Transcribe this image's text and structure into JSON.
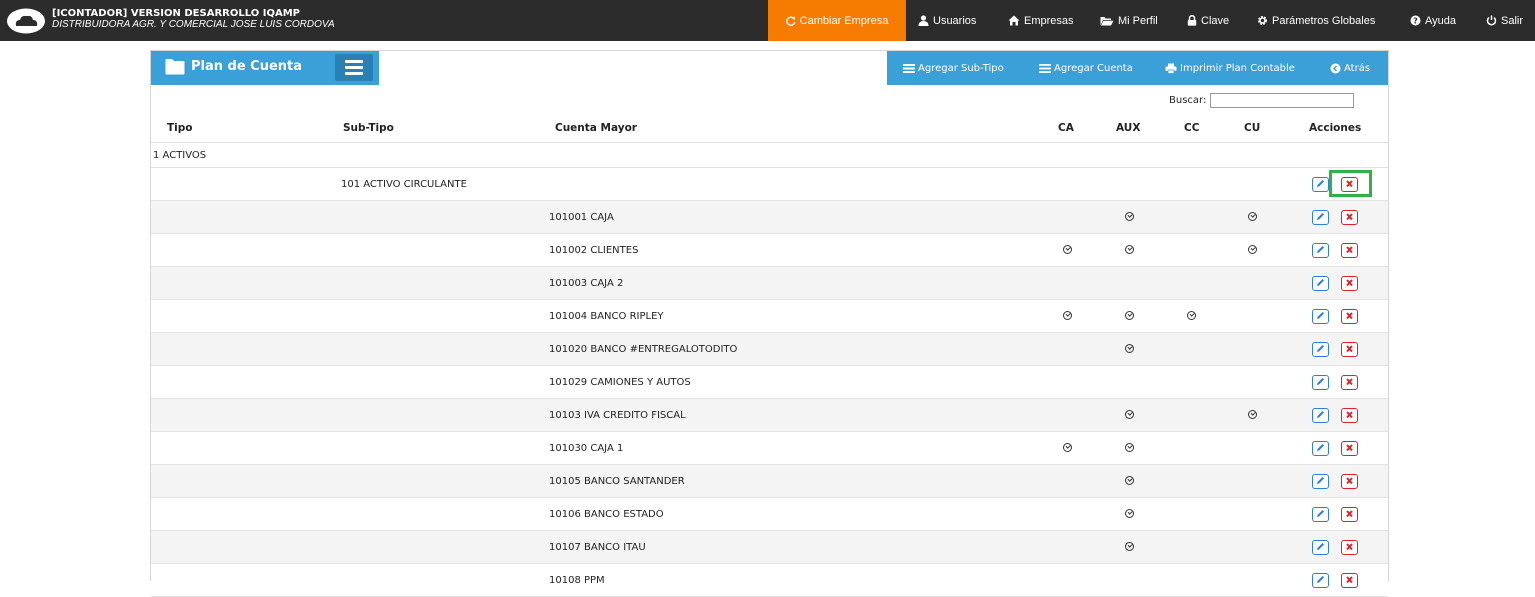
{
  "header": {
    "title": "[ICONTADOR] VERSION DESARROLLO IQAMP",
    "subtitle": "DISTRIBUIDORA AGR. Y COMERCIAL JOSE LUIS CORDOVA",
    "nav": [
      {
        "label": "Cambiar Empresa",
        "icon": "refresh-icon"
      },
      {
        "label": "Usuarios",
        "icon": "user-icon"
      },
      {
        "label": "Empresas",
        "icon": "home-icon"
      },
      {
        "label": "Mi Perfil",
        "icon": "folder-open-icon"
      },
      {
        "label": "Clave",
        "icon": "lock-icon"
      },
      {
        "label": "Parámetros Globales",
        "icon": "gear-icon"
      },
      {
        "label": "Ayuda",
        "icon": "help-icon"
      },
      {
        "label": "Salir",
        "icon": "power-icon"
      }
    ],
    "colors": {
      "bar": "#2c2c2c",
      "active": "#f57c00"
    }
  },
  "panel": {
    "title": "Plan de Cuenta",
    "actions": [
      {
        "label": "Agregar Sub-Tipo",
        "icon": "stack-icon"
      },
      {
        "label": "Agregar Cuenta",
        "icon": "list-icon"
      },
      {
        "label": "Imprimir Plan Contable",
        "icon": "print-icon"
      },
      {
        "label": "Atrás",
        "icon": "back-icon"
      }
    ],
    "search_label": "Buscar:",
    "search_value": "",
    "accent": "#3b9fd8"
  },
  "table": {
    "columns": [
      "Tipo",
      "Sub-Tipo",
      "Cuenta Mayor",
      "CA",
      "AUX",
      "CC",
      "CU",
      "Acciones"
    ],
    "rows": [
      {
        "tipo": "1 ACTIVOS",
        "subtipo": "",
        "cuenta": "",
        "ca": false,
        "aux": false,
        "cc": false,
        "cu": false,
        "actions": false
      },
      {
        "tipo": "",
        "subtipo": "101 ACTIVO CIRCULANTE",
        "cuenta": "",
        "ca": false,
        "aux": false,
        "cc": false,
        "cu": false,
        "actions": true
      },
      {
        "tipo": "",
        "subtipo": "",
        "cuenta": "101001 CAJA",
        "ca": false,
        "aux": true,
        "cc": false,
        "cu": true,
        "actions": true
      },
      {
        "tipo": "",
        "subtipo": "",
        "cuenta": "101002 CLIENTES",
        "ca": true,
        "aux": true,
        "cc": false,
        "cu": true,
        "actions": true
      },
      {
        "tipo": "",
        "subtipo": "",
        "cuenta": "101003 CAJA 2",
        "ca": false,
        "aux": false,
        "cc": false,
        "cu": false,
        "actions": true
      },
      {
        "tipo": "",
        "subtipo": "",
        "cuenta": "101004 BANCO RIPLEY",
        "ca": true,
        "aux": true,
        "cc": true,
        "cu": false,
        "actions": true
      },
      {
        "tipo": "",
        "subtipo": "",
        "cuenta": "101020 BANCO #ENTREGALOTODITO",
        "ca": false,
        "aux": true,
        "cc": false,
        "cu": false,
        "actions": true
      },
      {
        "tipo": "",
        "subtipo": "",
        "cuenta": "101029 CAMIONES Y AUTOS",
        "ca": false,
        "aux": false,
        "cc": false,
        "cu": false,
        "actions": true
      },
      {
        "tipo": "",
        "subtipo": "",
        "cuenta": "10103 IVA CREDITO FISCAL",
        "ca": false,
        "aux": true,
        "cc": false,
        "cu": true,
        "actions": true
      },
      {
        "tipo": "",
        "subtipo": "",
        "cuenta": "101030 CAJA 1",
        "ca": true,
        "aux": true,
        "cc": false,
        "cu": false,
        "actions": true
      },
      {
        "tipo": "",
        "subtipo": "",
        "cuenta": "10105 BANCO SANTANDER",
        "ca": false,
        "aux": true,
        "cc": false,
        "cu": false,
        "actions": true
      },
      {
        "tipo": "",
        "subtipo": "",
        "cuenta": "10106 BANCO ESTADO",
        "ca": false,
        "aux": true,
        "cc": false,
        "cu": false,
        "actions": true
      },
      {
        "tipo": "",
        "subtipo": "",
        "cuenta": "10107 BANCO ITAU",
        "ca": false,
        "aux": true,
        "cc": false,
        "cu": false,
        "actions": true
      },
      {
        "tipo": "",
        "subtipo": "",
        "cuenta": "10108 PPM",
        "ca": false,
        "aux": false,
        "cc": false,
        "cu": false,
        "actions": true
      }
    ]
  }
}
